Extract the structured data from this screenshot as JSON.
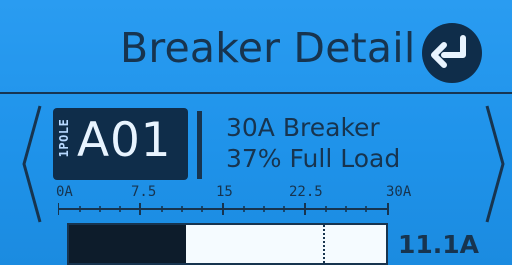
{
  "screen": {
    "title": "Breaker Detail",
    "breaker": {
      "pole": "1POLE",
      "id": "A01",
      "rating": "30A Breaker",
      "load": "37% Full Load",
      "current": "11.1A"
    },
    "scale": {
      "labels": [
        "0A",
        "7.5",
        "15",
        "22.5",
        "30A"
      ],
      "max_amps": 30
    },
    "load_bar": {
      "fill_fraction": 0.37,
      "threshold_fraction": 0.8
    },
    "icons": {
      "back": "return-arrow-icon",
      "previous": "left-arrow-icon",
      "next": "right-arrow-icon"
    }
  }
}
